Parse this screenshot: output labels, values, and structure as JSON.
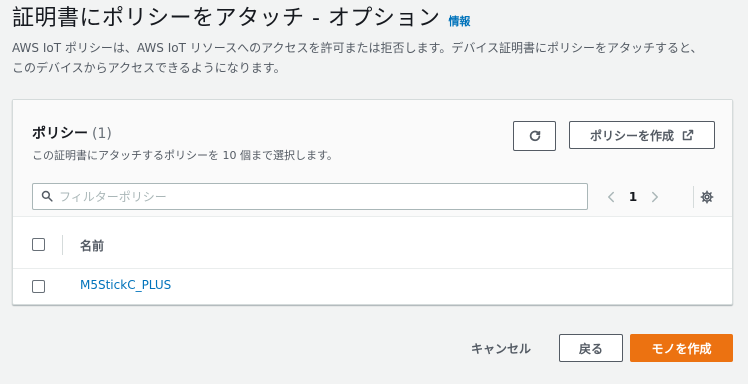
{
  "header": {
    "title": "証明書にポリシーをアタッチ - オプション",
    "info_link": "情報",
    "description_line1": "AWS IoT ポリシーは、AWS IoT リソースへのアクセスを許可または拒否します。デバイス証明書にポリシーをアタッチすると、",
    "description_line2": "このデバイスからアクセスできるようになります。"
  },
  "policies_panel": {
    "title": "ポリシー",
    "count": "(1)",
    "subtitle": "この証明書にアタッチするポリシーを 10 個まで選択します。",
    "refresh_icon": "refresh-icon",
    "create_policy_label": "ポリシーを作成",
    "external_icon": "external-link-icon",
    "search_placeholder": "フィルターポリシー",
    "search_value": "",
    "pagination": {
      "current_page": "1"
    },
    "table": {
      "columns": [
        "名前"
      ],
      "rows": [
        {
          "name": "M5StickC_PLUS",
          "selected": false
        }
      ]
    }
  },
  "footer": {
    "cancel_label": "キャンセル",
    "back_label": "戻る",
    "create_label": "モノを作成"
  },
  "colors": {
    "primary": "#ec7211",
    "link": "#0073bb",
    "text": "#16191f",
    "muted": "#545b64",
    "background": "#f2f3f3"
  }
}
